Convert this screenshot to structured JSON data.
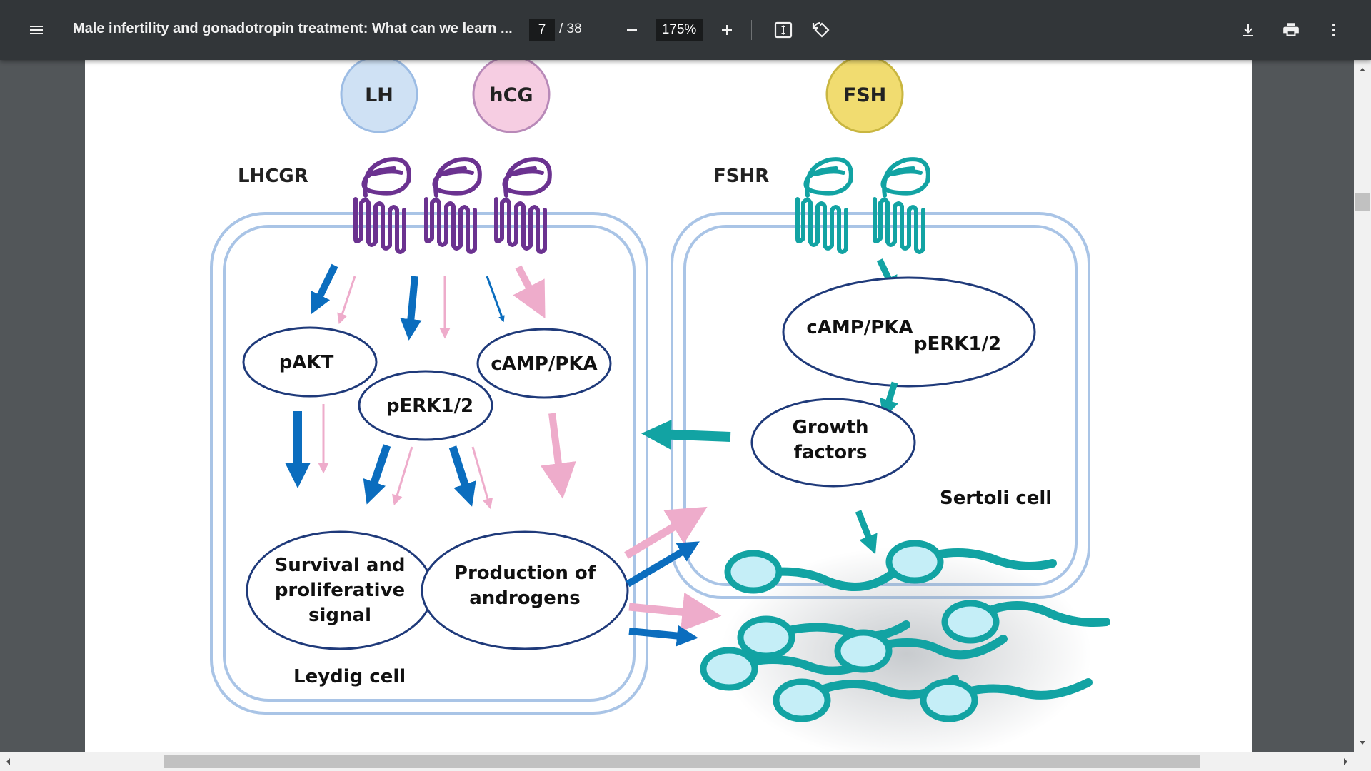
{
  "toolbar": {
    "title": "Male infertility and gonadotropin treatment: What can we learn ...",
    "page_current": "7",
    "page_total": "/ 38",
    "zoom": "175%"
  },
  "icons": {
    "menu": "menu-icon",
    "minus": "minus-icon",
    "plus": "plus-icon",
    "fit": "fit-to-page-icon",
    "rotate": "rotate-icon",
    "download": "download-icon",
    "print": "print-icon",
    "more": "more-vert-icon"
  },
  "diagram": {
    "hormones": {
      "lh": "LH",
      "hcg": "hCG",
      "fsh": "FSH"
    },
    "receptors": {
      "lhcgr": "LHCGR",
      "fshr": "FSHR"
    },
    "leydig": {
      "pakt": "pAKT",
      "perk": "pERK1/2",
      "camp": "cAMP/PKA",
      "survival": [
        "Survival and",
        "proliferative",
        "signal"
      ],
      "production": [
        "Production of",
        "androgens"
      ],
      "cell_label": "Leydig cell"
    },
    "sertoli": {
      "camp": "cAMP/PKA",
      "perk": "pERK1/2",
      "growth": [
        "Growth",
        "factors"
      ],
      "cell_label": "Sertoli cell"
    },
    "colors": {
      "blue": "#0b6dbe",
      "pink": "#eeaccb",
      "teal": "#12a3a3",
      "purple": "#6b3290",
      "lh_fill": "#cfe1f4",
      "hcg_fill": "#f6cde2",
      "fsh_fill": "#f1dc70",
      "cell_border": "#a9c4e6",
      "oval_border": "#1f3a7a"
    }
  }
}
